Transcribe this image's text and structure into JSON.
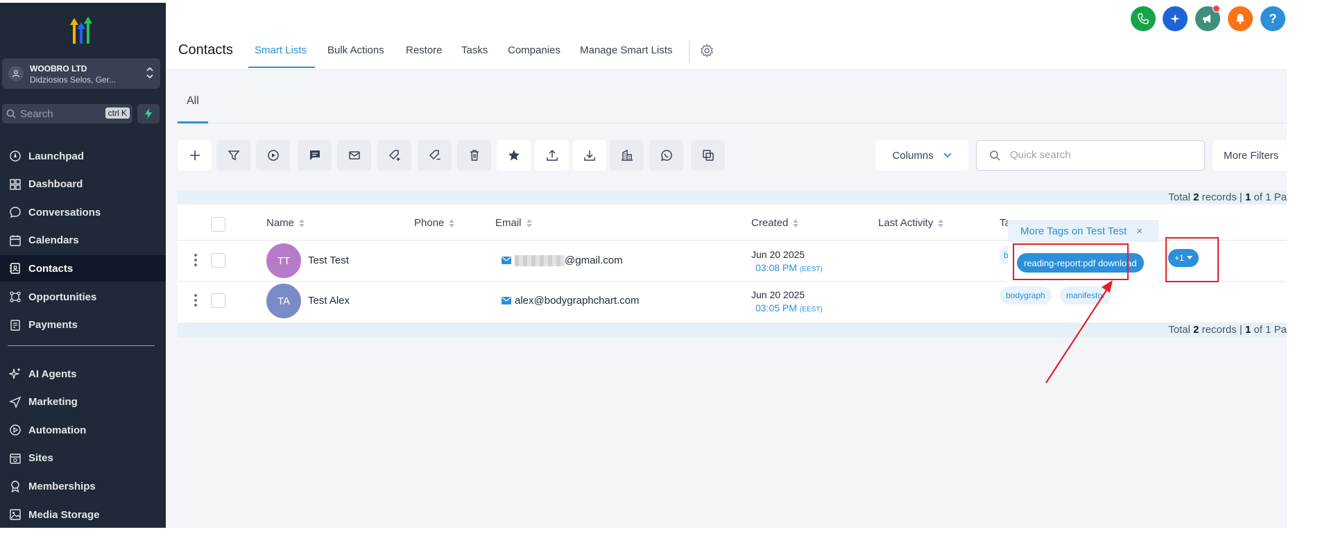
{
  "sidebar": {
    "org": {
      "name": "WOOBRO LTD",
      "address": "Didziosios Selos, Ger..."
    },
    "search": {
      "placeholder": "Search",
      "shortcut": "ctrl K"
    },
    "nav_top": [
      {
        "label": "Launchpad",
        "icon": "launchpad-icon"
      },
      {
        "label": "Dashboard",
        "icon": "dashboard-icon"
      },
      {
        "label": "Conversations",
        "icon": "chat-bubble-icon"
      },
      {
        "label": "Calendars",
        "icon": "calendar-icon"
      },
      {
        "label": "Contacts",
        "icon": "contacts-icon",
        "active": true
      },
      {
        "label": "Opportunities",
        "icon": "opportunities-icon"
      },
      {
        "label": "Payments",
        "icon": "payments-icon"
      }
    ],
    "nav_bottom": [
      {
        "label": "AI Agents",
        "icon": "sparkle-icon"
      },
      {
        "label": "Marketing",
        "icon": "send-icon"
      },
      {
        "label": "Automation",
        "icon": "automation-icon"
      },
      {
        "label": "Sites",
        "icon": "sites-icon"
      },
      {
        "label": "Memberships",
        "icon": "award-icon"
      },
      {
        "label": "Media Storage",
        "icon": "image-icon"
      }
    ]
  },
  "header": {
    "title": "Contacts",
    "tabs": [
      "Smart Lists",
      "Bulk Actions",
      "Restore",
      "Tasks",
      "Companies",
      "Manage Smart Lists"
    ],
    "active_tab": "Smart Lists",
    "top_icons": [
      "phone-icon",
      "sparkle-icon",
      "megaphone-icon",
      "bell-icon",
      "help-icon"
    ],
    "colors": {
      "phone": "#16a34a",
      "sparkle": "#1d64d8",
      "megaphone": "#3f8f7c",
      "bell": "#f97316",
      "help": "#2b8fd9"
    }
  },
  "subtabs": {
    "all": "All"
  },
  "toolbar": {
    "columns_label": "Columns",
    "quick_search_placeholder": "Quick search",
    "more_filters_label": "More Filters"
  },
  "records": {
    "prefix": "Total",
    "count": "2",
    "middle": "records |",
    "page": "1",
    "suffix": "of 1 Pa"
  },
  "table": {
    "headers": {
      "name": "Name",
      "phone": "Phone",
      "email": "Email",
      "created": "Created",
      "last_activity": "Last Activity",
      "tags": "Ta"
    },
    "rows": [
      {
        "initials": "TT",
        "avatar_color": "#b77ac8",
        "name": "Test Test",
        "email": "@gmail.com",
        "date": "Jun 20 2025",
        "time": "03:08 PM",
        "tz": "(EEST)",
        "tags_visible": [
          "b"
        ]
      },
      {
        "initials": "TA",
        "avatar_color": "#7b8bc7",
        "name": "Test Alex",
        "email": "alex@bodygraphchart.com",
        "date": "Jun 20 2025",
        "time": "03:05 PM",
        "tz": "(EEST)",
        "tags_visible": [
          "bodygraph",
          "manifestor"
        ]
      }
    ]
  },
  "popover": {
    "title": "More Tags on Test Test",
    "close": "×",
    "tag": "reading-report:pdf download",
    "more_button": "+1"
  }
}
